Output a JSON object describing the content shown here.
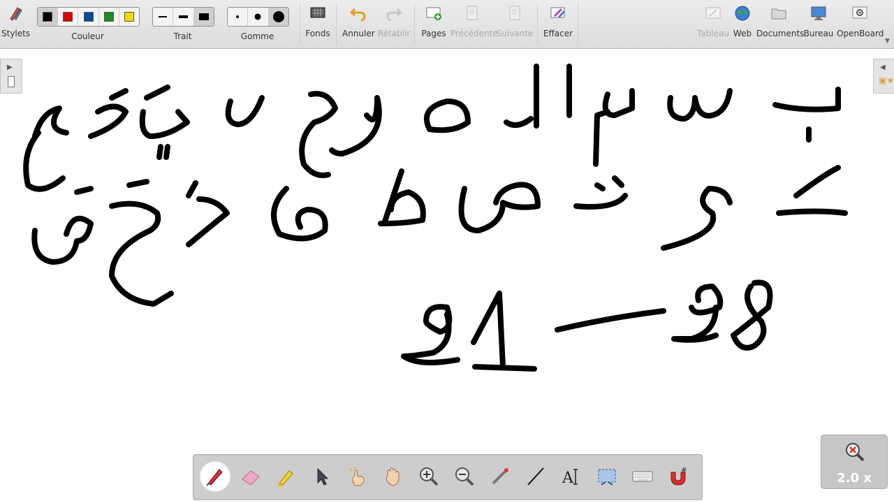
{
  "toolbar": {
    "stylets": "Stylets",
    "couleur": "Couleur",
    "colors": [
      "#000000",
      "#e00000",
      "#0a4c99",
      "#1e8c1e",
      "#f2d600"
    ],
    "trait": "Trait",
    "gomme": "Gomme",
    "fonds": "Fonds",
    "annuler": "Annuler",
    "retablir": "Rétablir",
    "pages": "Pages",
    "precedente": "Précédente",
    "suivante": "Suivante",
    "effacer": "Effacer",
    "tableau": "Tableau",
    "web": "Web",
    "documents": "Documents",
    "bureau": "Bureau",
    "openboard": "OpenBoard"
  },
  "dock": {
    "tools": [
      "pen-icon",
      "eraser-icon",
      "marker-icon",
      "pointer-icon",
      "interact-icon",
      "hand-icon",
      "zoom-in-icon",
      "zoom-out-icon",
      "laser-icon",
      "line-icon",
      "text-icon",
      "capture-icon",
      "keyboard-icon",
      "magnet-icon"
    ]
  },
  "zoom": {
    "level": "2.0 x"
  }
}
